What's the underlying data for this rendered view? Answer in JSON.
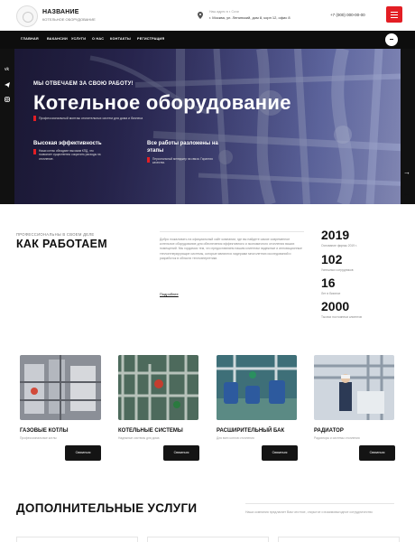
{
  "header": {
    "brand_title": "НАЗВАНИЕ",
    "brand_sub": "КОТЕЛЬНОЕ ОБОРУДОВАНИЕ",
    "address_label": "Наш адрес в г. Сочи",
    "address_value": "г. Москва, ул. Ленинский, дом 8, корп 12, офис 8",
    "phone": "+7 (000) 000-00-00"
  },
  "nav": {
    "items": [
      "ГЛАВНАЯ",
      "ВАКАНСИИ",
      "УСЛУГИ",
      "О НАС",
      "КОНТАКТЫ",
      "РЕГИСТРАЦИЯ"
    ]
  },
  "hero": {
    "kicker": "МЫ ОТВЕЧАЕМ ЗА СВОЮ РАБОТУ!",
    "title": "Котельное оборудование",
    "desc": "Профессиональный монтаж отопительных систем для дома и бизнеса",
    "features": [
      {
        "title": "Высокая эффективность",
        "text": [
          "Наши котлы обладают высоким КПД, что",
          "позволяет существенно сократить расходы на",
          "отопление."
        ]
      },
      {
        "title": "Все работы разложены на",
        "title2": "этапы",
        "text": [
          "Персональный менеджер на связи. Гарантия",
          "качества."
        ]
      }
    ]
  },
  "how": {
    "kicker": "ПРОФЕССИОНАЛЬНЫ В СВОЕМ ДЕЛЕ",
    "title": "КАК РАБОТАЕМ",
    "intro": "Добро пожаловать на официальный сайт компании, где вы найдете самое современное котельное оборудование для обеспечения эффективного и экономичного отопления ваших помещений. Мы гордимся тем, что предоставляем нашим клиентам надежные и инновационные теплогенерирующие системы, которые являются лидерами многолетних исследований и разработок в области теплоэнергетики.",
    "more": "Подробнее",
    "stats": [
      {
        "num": "2019",
        "label": "Основание фирмы 2019 г."
      },
      {
        "num": "102",
        "label": "Успешных сотрудников"
      },
      {
        "num": "16",
        "label": "Лет в бизнесе"
      },
      {
        "num": "2000",
        "label": "Тысячи постоянных клиентов"
      }
    ]
  },
  "products": [
    {
      "title": "ГАЗОВЫЕ КОТЛЫ",
      "sub": "Профессиональные котлы",
      "btn": "Связаться"
    },
    {
      "title": "КОТЕЛЬНЫЕ СИСТЕМЫ",
      "sub": "Надежные системы для дома",
      "btn": "Связаться"
    },
    {
      "title": "РАСШИРИТЕЛЬНЫЙ БАК",
      "sub": "Для всех котлов отопления",
      "btn": "Связаться"
    },
    {
      "title": "РАДИАТОР",
      "sub": "Радиаторы и системы отопления",
      "btn": "Связаться"
    }
  ],
  "extra": {
    "title": "ДОПОЛНИТЕЛЬНЫЕ УСЛУГИ",
    "text": "Наша компания предлагает Вам честное, открытое и взаимовыгодное сотрудничество"
  },
  "colors": {
    "accent": "#e31e24",
    "dark": "#0d0d0d"
  }
}
